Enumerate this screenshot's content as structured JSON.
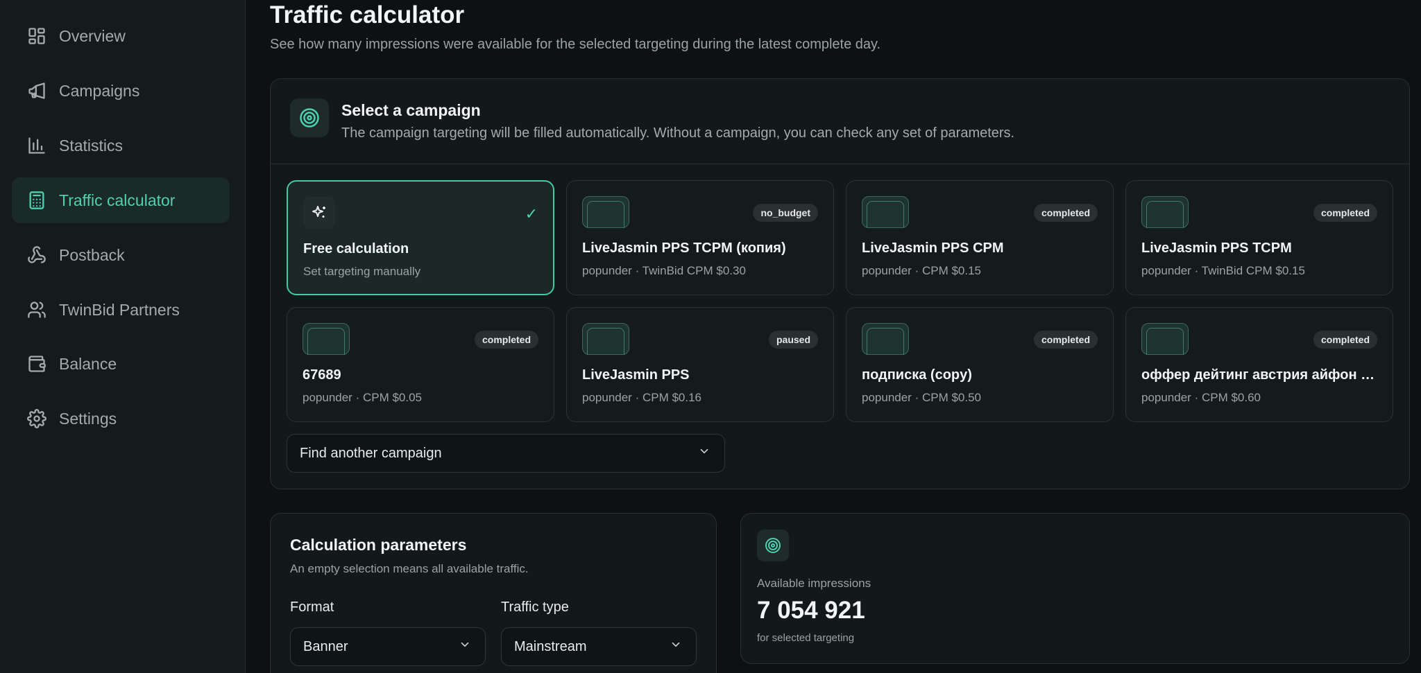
{
  "sidebar": {
    "items": [
      {
        "label": "Overview",
        "icon": "grid-icon"
      },
      {
        "label": "Campaigns",
        "icon": "megaphone-icon"
      },
      {
        "label": "Statistics",
        "icon": "bar-chart-icon"
      },
      {
        "label": "Traffic calculator",
        "icon": "calculator-icon",
        "active": true
      },
      {
        "label": "Postback",
        "icon": "webhook-icon"
      },
      {
        "label": "TwinBid Partners",
        "icon": "users-icon"
      },
      {
        "label": "Balance",
        "icon": "wallet-icon"
      },
      {
        "label": "Settings",
        "icon": "gear-icon"
      }
    ]
  },
  "page": {
    "title": "Traffic calculator",
    "subtitle": "See how many impressions were available for the selected targeting during the latest complete day."
  },
  "campaign_select": {
    "title": "Select a campaign",
    "subtitle": "The campaign targeting will be filled automatically. Without a campaign, you can check any set of parameters.",
    "cards": [
      {
        "name": "Free calculation",
        "meta": "Set targeting manually",
        "badge": "",
        "selected": true
      },
      {
        "name": "LiveJasmin PPS TCPM (копия)",
        "meta": "popunder · TwinBid CPM $0.30",
        "badge": "no_budget"
      },
      {
        "name": "LiveJasmin PPS CPM",
        "meta": "popunder · CPM $0.15",
        "badge": "completed"
      },
      {
        "name": "LiveJasmin PPS TCPM",
        "meta": "popunder · TwinBid CPM $0.15",
        "badge": "completed"
      },
      {
        "name": "67689",
        "meta": "popunder · CPM $0.05",
        "badge": "completed"
      },
      {
        "name": "LiveJasmin PPS",
        "meta": "popunder · CPM $0.16",
        "badge": "paused"
      },
      {
        "name": "подписка (copy)",
        "meta": "popunder · CPM $0.50",
        "badge": "completed"
      },
      {
        "name": "оффер дейтинг австрия айфон …",
        "meta": "popunder · CPM $0.60",
        "badge": "completed"
      }
    ],
    "find_label": "Find another campaign"
  },
  "params": {
    "title": "Calculation parameters",
    "subtitle": "An empty selection means all available traffic.",
    "format_label": "Format",
    "format_value": "Banner",
    "traffic_label": "Traffic type",
    "traffic_value": "Mainstream"
  },
  "result": {
    "label": "Available impressions",
    "value": "7 054 921",
    "footnote": "for selected targeting"
  },
  "colors": {
    "accent": "#4fd1b0",
    "background": "#0d1113",
    "panel": "#131819"
  }
}
